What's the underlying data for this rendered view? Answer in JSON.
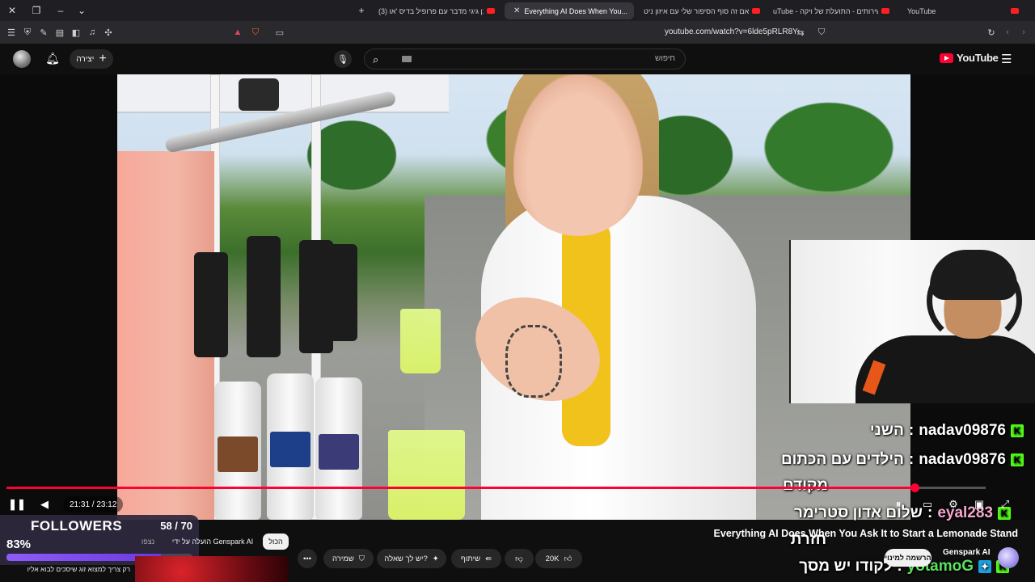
{
  "browser": {
    "tabs": [
      {
        "label": "YouTube",
        "active": false
      },
      {
        "label": "uTube - השירותים - התועלת של ויקה",
        "active": false
      },
      {
        "label": "האם זה סוף הסיפור שלי עם איזון ניט...",
        "active": false
      },
      {
        "label": "Everything AI Does When You...",
        "active": true
      },
      {
        "label": "(3) רונן גיגי מדבר עם פרופיל בדיס 'או",
        "active": false
      }
    ],
    "url": "youtube.com/watch?v=6lde5pRLR8Y"
  },
  "header": {
    "create_label": "יצירה",
    "search_placeholder": "חיפוש",
    "logo_text": "YouTube"
  },
  "player": {
    "current_time": "21:31",
    "duration": "23:12",
    "time_display": "21:31 / 23:12",
    "progress_fraction": 0.9274
  },
  "chat": [
    {
      "platform": "kick",
      "user": "nadav09876",
      "message": "השני"
    },
    {
      "platform": "kick",
      "user": "nadav09876",
      "message": "הילדים עם הכתום"
    },
    {
      "platform": "",
      "user": "",
      "message": "מקודם"
    },
    {
      "platform": "kick",
      "user": "eyal283",
      "message": "שלום אדון סטרימר"
    },
    {
      "platform": "",
      "user": "",
      "message": "חזרת"
    },
    {
      "platform": "kick",
      "user": "yotamoG",
      "message": "לקודו יש מסך"
    }
  ],
  "followers_widget": {
    "title": "FOLLOWERS",
    "current": 58,
    "goal": 70,
    "count_text": "58 / 70",
    "percent_text": "83%",
    "fraction": 0.83
  },
  "video_info": {
    "title": "Everything AI Does When You Ask It to Start a Lemonade Stand",
    "channel": "Genspark AI",
    "subscribe_label": "הרשמה למינוי",
    "likes": "20K",
    "share_label": "שיתוף",
    "ask_label": "יש לך שאלה?",
    "save_label": "שמירה"
  },
  "chips": {
    "all_label": "הכול",
    "uploaded_by": "הועלה על ידי Genspark AI",
    "watched": "נצפו"
  },
  "suggestion": {
    "text": "רק צריך למצוא זוג שיסכים לבוא אליו"
  },
  "colors": {
    "accent_red": "#ff0033",
    "kick_green": "#53fc18",
    "follower_purple": "#8e5cf7"
  }
}
